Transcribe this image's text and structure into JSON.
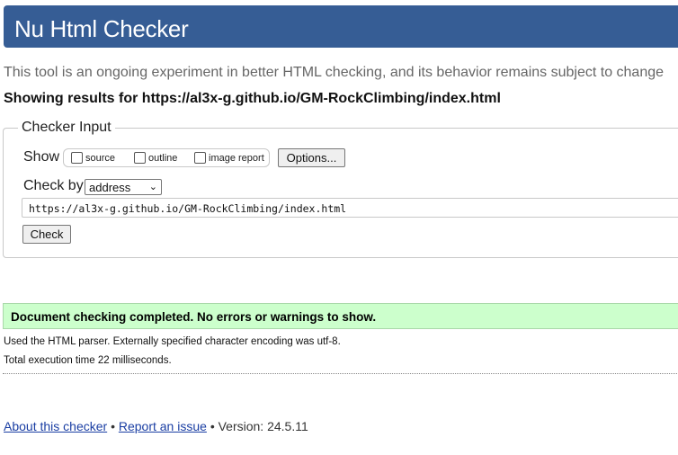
{
  "header": {
    "title": "Nu Html Checker"
  },
  "intro": "This tool is an ongoing experiment in better HTML checking, and its behavior remains subject to change",
  "showing": "Showing results for https://al3x-g.github.io/GM-RockClimbing/index.html",
  "checker_input": {
    "legend": "Checker Input",
    "show_label": "Show",
    "options": [
      {
        "label": "source",
        "checked": false
      },
      {
        "label": "outline",
        "checked": false
      },
      {
        "label": "image report",
        "checked": false
      }
    ],
    "options_button": "Options...",
    "check_by_label": "Check by",
    "check_by_value": "address",
    "url_value": "https://al3x-g.github.io/GM-RockClimbing/index.html",
    "check_button": "Check"
  },
  "result": {
    "success_message": "Document checking completed. No errors or warnings to show.",
    "parser_info": "Used the HTML parser. Externally specified character encoding was utf-8.",
    "execution_time": "Total execution time 22 milliseconds."
  },
  "footer": {
    "about_link": "About this checker",
    "separator": "•",
    "report_link": "Report an issue",
    "version": "Version: 24.5.11"
  },
  "colors": {
    "header_bg": "#365d95",
    "success_bg": "#ccffcc",
    "link": "#1a3ea3"
  }
}
